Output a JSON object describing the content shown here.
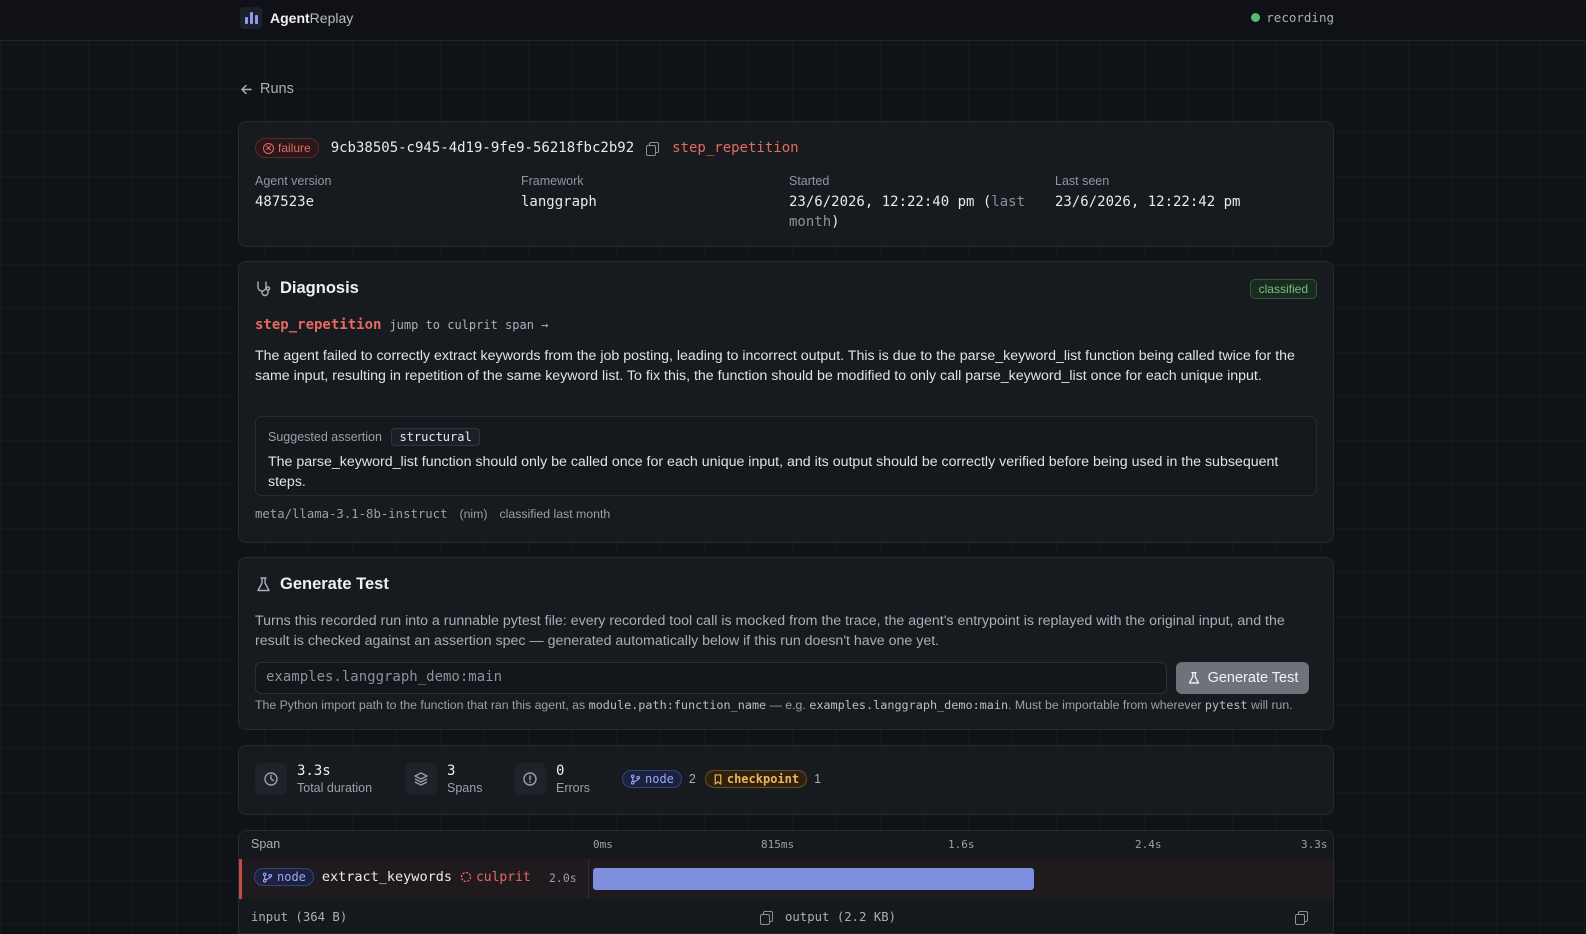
{
  "app": {
    "brand_bold": "Agent",
    "brand_light": "Replay",
    "status": "recording"
  },
  "nav": {
    "back_label": "Runs"
  },
  "run": {
    "status": "failure",
    "id": "9cb38505-c945-4d19-9fe9-56218fbc2b92",
    "failure_type": "step_repetition",
    "agent_version_label": "Agent version",
    "agent_version": "487523e",
    "framework_label": "Framework",
    "framework": "langgraph",
    "started_label": "Started",
    "started": "23/6/2026, 12:22:40 pm (",
    "started_rel": "last month",
    "started_close": ")",
    "last_seen_label": "Last seen",
    "last_seen": "23/6/2026, 12:22:42 pm"
  },
  "diagnosis": {
    "title": "Diagnosis",
    "badge": "classified",
    "failure_type": "step_repetition",
    "jump_label": "jump to culprit span →",
    "summary": "The agent failed to correctly extract keywords from the job posting, leading to incorrect output. This is due to the parse_keyword_list function being called twice for the same input, resulting in repetition of the same keyword list. To fix this, the function should be modified to only call parse_keyword_list once for each unique input.",
    "assertion_label": "Suggested assertion",
    "assertion_tag": "structural",
    "assertion_text": "The parse_keyword_list function should only be called once for each unique input, and its output should be correctly verified before being used in the subsequent steps.",
    "model": "meta/llama-3.1-8b-instruct",
    "provider": "(nim)",
    "classified_when": "classified last month"
  },
  "generate": {
    "title": "Generate Test",
    "description": "Turns this recorded run into a runnable pytest file: every recorded tool call is mocked from the trace, the agent's entrypoint is replayed with the original input, and the result is checked against an assertion spec — generated automatically below if this run doesn't have one yet.",
    "placeholder": "examples.langgraph_demo:main",
    "button": "Generate Test",
    "hint_1": "The Python import path to the function that ran this agent, as ",
    "hint_code_1": "module.path:function_name",
    "hint_2": " — e.g. ",
    "hint_code_2": "examples.langgraph_demo:main",
    "hint_3": ". Must be importable from wherever ",
    "hint_code_3": "pytest",
    "hint_4": " will run."
  },
  "stats": {
    "duration": "3.3s",
    "duration_label": "Total duration",
    "spans": "3",
    "spans_label": "Spans",
    "errors": "0",
    "errors_label": "Errors",
    "node_label": "node",
    "node_count": "2",
    "checkpoint_label": "checkpoint",
    "checkpoint_count": "1"
  },
  "timeline": {
    "span_header": "Span",
    "ticks": [
      "0ms",
      "815ms",
      "1.6s",
      "2.4s",
      "3.3s"
    ],
    "row": {
      "kind": "node",
      "name": "extract_keywords",
      "flag": "culprit",
      "duration": "2.0s",
      "start_s": 0.0,
      "end_s": 2.0,
      "total_s": 3.3
    },
    "input_label": "input (364 B)",
    "output_label": "output (2.2 KB)"
  }
}
